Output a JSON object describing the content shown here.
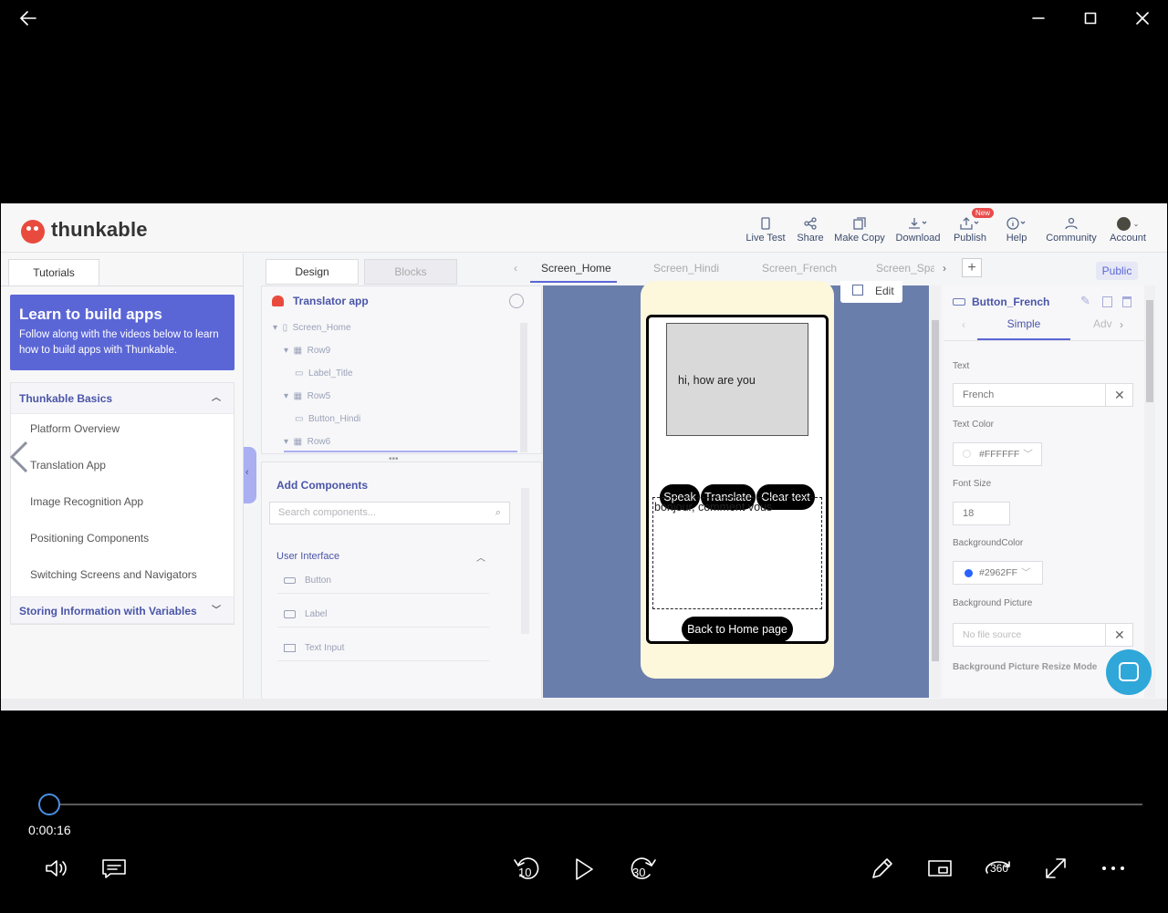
{
  "window": {
    "back": "back",
    "min": "minimize",
    "max": "maximize",
    "close": "close"
  },
  "app": {
    "logo": "thunkable",
    "toolbar": [
      {
        "label": "Live Test",
        "icon": "phone-icon"
      },
      {
        "label": "Share",
        "icon": "share-icon"
      },
      {
        "label": "Make Copy",
        "icon": "copy-icon"
      },
      {
        "label": "Download",
        "icon": "download-icon"
      },
      {
        "label": "Publish",
        "icon": "publish-icon",
        "badge": "New"
      },
      {
        "label": "Help",
        "icon": "info-icon"
      },
      {
        "label": "Community",
        "icon": "community-icon"
      },
      {
        "label": "Account",
        "icon": "avatar-icon"
      }
    ],
    "left": {
      "tab": "Tutorials",
      "learn_title": "Learn to build apps",
      "learn_text": "Follow along with the videos below to learn how to build apps with Thunkable.",
      "section1": "Thunkable Basics",
      "items": [
        "Platform Overview",
        "Translation App",
        "Image Recognition App",
        "Positioning Components",
        "Switching Screens and Navigators"
      ],
      "section2": "Storing Information with Variables"
    },
    "design_tab": "Design",
    "blocks_tab": "Blocks",
    "screens": [
      "Screen_Home",
      "Screen_Hindi",
      "Screen_French",
      "Screen_Span"
    ],
    "public": "Public",
    "project": "Translator app",
    "tree": [
      "Screen_Home",
      "Row9",
      "Label_Title",
      "Row5",
      "Button_Hindi",
      "Row6"
    ],
    "add_components": "Add Components",
    "search_placeholder": "Search components...",
    "ui_group": "User Interface",
    "components": [
      "Button",
      "Label",
      "Text Input"
    ],
    "edit": "Edit",
    "phone": {
      "input_text": "hi, how are you",
      "buttons": [
        "Speak",
        "Translate",
        "Clear text"
      ],
      "output_text": "bonjour, comment vous",
      "back_button": "Back to Home page"
    },
    "props": {
      "component": "Button_French",
      "tab_simple": "Simple",
      "tab_adv": "Adv",
      "text_label": "Text",
      "text_value": "French",
      "color_label": "Text Color",
      "color_value": "#FFFFFF",
      "size_label": "Font Size",
      "size_value": "18",
      "bg_label": "BackgroundColor",
      "bg_value": "#2962FF",
      "bgpic_label": "Background Picture",
      "bgpic_value": "No file source",
      "resize_label": "Background Picture Resize Mode"
    }
  },
  "player": {
    "time": "0:00:16",
    "progress": 0.01,
    "rewind": "10",
    "forward": "30"
  },
  "colors": {
    "accent": "#5b66d6",
    "phone_bg": "#fdf7dc",
    "canvas": "#6a7eab",
    "chat": "#2fa7d8"
  }
}
